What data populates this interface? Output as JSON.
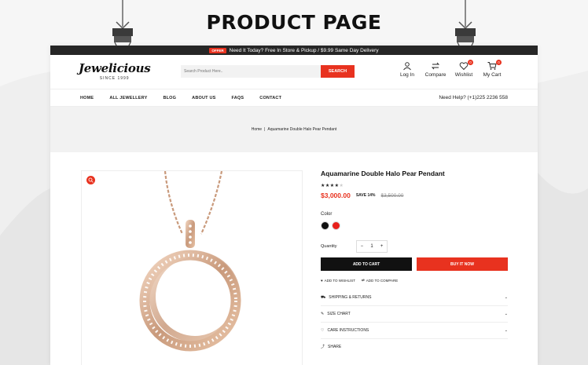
{
  "showcase": {
    "title": "PRODUCT PAGE"
  },
  "promo": {
    "badge": "OFFER",
    "text": "Need It Today? Free In Store & Pickup / $9.99 Same Day Delivery"
  },
  "header": {
    "logo_name": "Jewelicious",
    "logo_since": "SINCE 1999",
    "search_placeholder": "Search Product Here..",
    "search_button": "SEARCH",
    "icons": [
      {
        "label": "Log In",
        "icon": "user-icon"
      },
      {
        "label": "Compare",
        "icon": "compare-icon"
      },
      {
        "label": "Wishlist",
        "icon": "heart-icon",
        "count": "0"
      },
      {
        "label": "My Cart",
        "icon": "cart-icon",
        "count": "0"
      }
    ]
  },
  "nav": {
    "items": [
      "HOME",
      "ALL JEWELLERY",
      "BLOG",
      "ABOUT US",
      "FAQS",
      "CONTACT"
    ],
    "help": "Need Help? (+1)225 2236 558"
  },
  "breadcrumb": {
    "home": "Home",
    "separator": "|",
    "current": "Aquamarine Double Halo Pear Pendant"
  },
  "product": {
    "title": "Aquamarine Double Halo Pear Pendant",
    "rating": 4,
    "rating_max": 5,
    "price": "$3,000.00",
    "save": "SAVE 14%",
    "old_price": "$3,500.00",
    "color_label": "Color",
    "colors": [
      "#111111",
      "#e8201b"
    ],
    "quantity_label": "Quantity",
    "quantity": "1",
    "minus": "−",
    "plus": "+",
    "add_to_cart": "ADD TO CART",
    "buy_now": "BUY IT NOW",
    "add_to_wishlist": "ADD TO WISHLIST",
    "add_to_compare": "ADD TO COMPARE",
    "accordion": [
      "SHIPPING & RETURNS",
      "SIZE CHART",
      "CARE INSTRUCTIONS"
    ],
    "share": "SHARE"
  },
  "colors": {
    "accent": "#e8321f",
    "dark": "#111111",
    "promo_bar": "#262626"
  }
}
